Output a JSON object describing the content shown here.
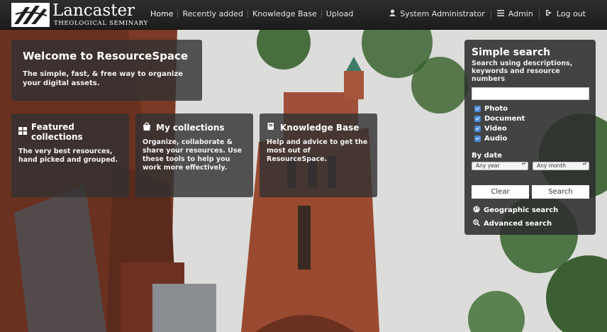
{
  "brand": {
    "name": "Lancaster",
    "subtitle": "THEOLOGICAL SEMINARY"
  },
  "nav": {
    "left": [
      "Home",
      "Recently added",
      "Knowledge Base",
      "Upload"
    ],
    "right": [
      {
        "label": "System Administrator",
        "icon": "user-icon"
      },
      {
        "label": "Admin",
        "icon": "menu-icon"
      },
      {
        "label": "Log out",
        "icon": "logout-icon"
      }
    ]
  },
  "welcome": {
    "title": "Welcome to ResourceSpace",
    "text": "The simple, fast, & free way to organize your digital assets."
  },
  "cards": [
    {
      "title": "Featured collections",
      "text": "The very best resources, hand picked and grouped.",
      "icon": "grid-icon"
    },
    {
      "title": "My collections",
      "text": "Organize, collaborate & share your resources. Use these tools to help you work more effectively.",
      "icon": "shopping-bag-icon"
    },
    {
      "title": "Knowledge Base",
      "text": "Help and advice to get the most out of ResourceSpace.",
      "icon": "book-icon"
    }
  ],
  "search": {
    "title": "Simple search",
    "hint": "Search using descriptions, keywords and resource numbers",
    "query": "",
    "types": [
      "Photo",
      "Document",
      "Video",
      "Audio"
    ],
    "by_date": "By date",
    "year": "Any year",
    "month": "Any month",
    "clear": "Clear",
    "submit": "Search",
    "geo": "Geographic search",
    "advanced": "Advanced search"
  }
}
